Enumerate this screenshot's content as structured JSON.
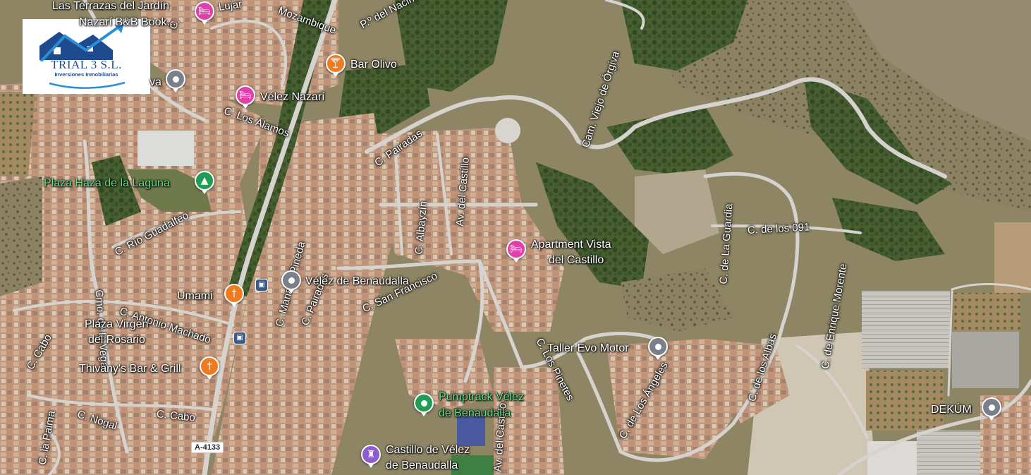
{
  "map": {
    "colors": {
      "terrain": "#8a8363",
      "vegetation": "#3d5428",
      "dense_trees": "#2f4a22",
      "town_roofs": "#c9a58f",
      "road": "#d9d6d2",
      "dry_scrub": "#9d8f6c"
    },
    "logo": {
      "name": "TRIAL 3 S.L.",
      "subtitle": "Inversiones Inmobiliarias",
      "colors": {
        "house": "#1f4b8e",
        "arrow": "#2a8fd6",
        "wave": "#2a8fd6"
      }
    },
    "pois": {
      "las_terrazas": {
        "label": "Las Terrazas del Jardín",
        "label2": "Nazarí B&B Book...",
        "icon": "bed-icon"
      },
      "bar_olivo": {
        "label": "Bar Olivo",
        "icon": "cocktail-icon"
      },
      "velez_nazari": {
        "label": "Vélez Nazarí",
        "icon": "bed-icon"
      },
      "va_place": {
        "label": "va",
        "icon": "pin-icon"
      },
      "plaza_haza": {
        "label": "Plaza Haza de la Laguna",
        "icon": "tree-icon"
      },
      "apartment": {
        "label": "Apartment Vista",
        "label2": "del Castillo",
        "icon": "bed-icon"
      },
      "velez_benaudalla": {
        "label": "Vélez de Benaudalla",
        "icon": "pin-icon"
      },
      "umami": {
        "label": "Umami",
        "icon": "restaurant-icon"
      },
      "plaza_virgen": {
        "label": "Plaza Virgen",
        "label2": "del Rosario"
      },
      "thivanys": {
        "label": "Thivany's Bar & Grill",
        "icon": "restaurant-icon"
      },
      "taller_evo": {
        "label": "Taller Evo Motor",
        "icon": "pin-icon"
      },
      "pumptrack": {
        "label": "Pumptrack Vélez",
        "label2": "de Benaudalla",
        "icon": "pin-icon"
      },
      "castillo": {
        "label": "Castillo de Vélez",
        "label2": "de Benaudalla",
        "icon": "castle-icon"
      },
      "dekum": {
        "label": "DEKÚM",
        "icon": "pin-icon"
      }
    },
    "streets": {
      "lujar": "Lujar",
      "mozambique": "Mozambique",
      "paseo_nacimiento": "P.º del Nacimiento",
      "c_alamos": "C. Los Álamos",
      "c_pairadas": "C. Pairadas",
      "av_castillo": "Av. del Castillo",
      "c_albayzin": "C. Albayzín",
      "cam_viejo_orgiva": "Cam. Viejo de Órgiva",
      "c_guardia": "C. de La Guardia",
      "c_los_091": "C. de los 091",
      "c_enrique_morente": "C. de Enrique Morente",
      "c_rio_guadalfeo": "C. Río Guadalfeo",
      "c_mariana_pineda": "C. Mariana Pineda",
      "c_pairadas_2": "C. Pairadas",
      "c_san_francisco": "C. San Francisco",
      "c_antonio_machado": "C. Antonio Machado",
      "cmo_vega": "Cmo. de la Vega",
      "c_cabo": "C. Cabo",
      "c_cabo_2": "C. Cabo",
      "c_la_palma": "C. la Palma",
      "c_nogal": "C. Nogal",
      "c_los_pinetes": "C. Los Pinetes",
      "c_los_angeles": "C. de Los Ángeles",
      "c_los_albas": "C. de los Albas",
      "av_castillo_2": "Av. del Castillo",
      "c_velez": "C."
    },
    "road_shield": "A-4133"
  }
}
